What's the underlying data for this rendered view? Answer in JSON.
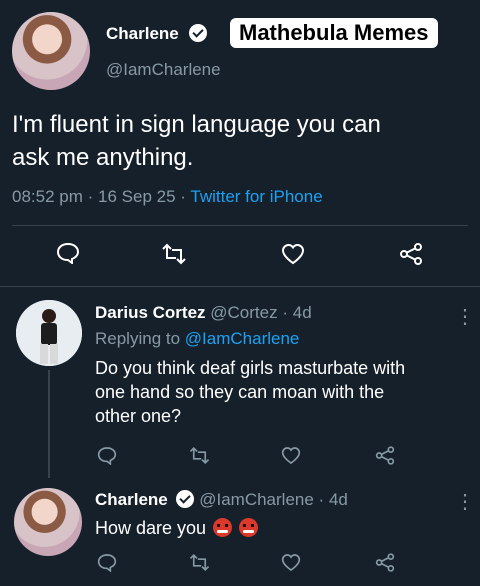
{
  "tweet": {
    "author_name": "Charlene",
    "author_handle": "@IamCharlene",
    "text_line1": "I'm fluent in sign language you can",
    "text_line2": "ask me anything.",
    "time": "08:52 pm",
    "date": "16 Sep 25",
    "source": "Twitter for iPhone"
  },
  "watermark": "Mathebula Memes",
  "reply1": {
    "author_name": "Darius Cortez",
    "author_handle": "@Cortez",
    "age": "4d",
    "replying_prefix": "Replying to",
    "replying_handle": "@IamCharlene",
    "text_line1": "Do you think deaf girls masturbate with",
    "text_line2": "one hand so they can moan with the",
    "text_line3": "other one?"
  },
  "reply2": {
    "author_name": "Charlene",
    "author_handle": "@IamCharlene",
    "age": "4d",
    "text": "How dare you"
  },
  "separator": "·",
  "more": "⋮",
  "icons": [
    "reply-icon",
    "retweet-icon",
    "like-icon",
    "share-icon",
    "verified-icon",
    "angry-emoji-icon"
  ],
  "colors": {
    "background": "#15202b",
    "secondary": "#8899a6",
    "link": "#1da1f2",
    "divider": "#38444d"
  }
}
